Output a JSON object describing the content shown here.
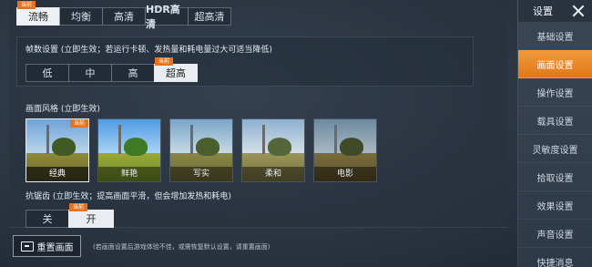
{
  "quality": {
    "badge": "当前",
    "options": [
      "流畅",
      "均衡",
      "高清",
      "HDR高清",
      "超高清"
    ],
    "selected_index": 0
  },
  "fps": {
    "label": "帧数设置 (立即生效；若运行卡顿、发热量和耗电量过大可适当降低)",
    "badge": "当前",
    "options": [
      "低",
      "中",
      "高",
      "超高"
    ],
    "selected_index": 3
  },
  "style": {
    "label": "画面风格 (立即生效)",
    "badge": "当前",
    "thumbs": [
      "经典",
      "鲜艳",
      "写实",
      "柔和",
      "电影"
    ],
    "selected_index": 0
  },
  "aa": {
    "label": "抗锯齿 (立即生效；提高画面平滑，但会增加发热和耗电)",
    "badge": "当前",
    "options": [
      "关",
      "开"
    ],
    "selected_index": 1
  },
  "reset": {
    "label": "重置画面",
    "note": "(若画面设置后游戏体验不佳，或需恢复默认设置，请重置画面)"
  },
  "sidebar": {
    "title": "设置",
    "items": [
      "基础设置",
      "画面设置",
      "操作设置",
      "载具设置",
      "灵敏度设置",
      "拾取设置",
      "效果设置",
      "声音设置",
      "快捷消息"
    ],
    "active_index": 1
  },
  "colors": {
    "accent": "#e8731e",
    "selected": "#e9edf1"
  }
}
